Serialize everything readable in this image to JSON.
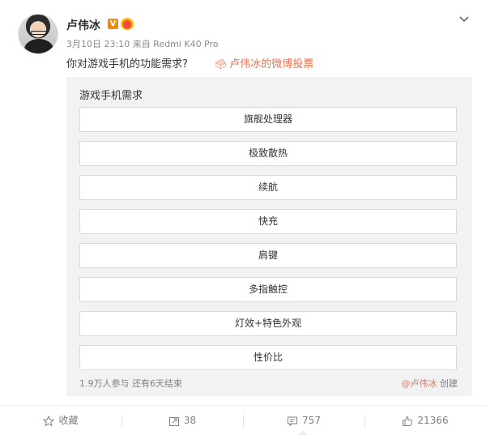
{
  "post": {
    "author": "卢伟冰",
    "verified_badge": "V",
    "meta": "3月10日 23:10 来自 Redmi K40 Pro",
    "question": "你对游戏手机的功能需求?",
    "vote_link_icon": "vote-icon",
    "vote_link": "卢伟冰的微博投票"
  },
  "poll": {
    "title": "游戏手机需求",
    "options": [
      "旗舰处理器",
      "极致散热",
      "续航",
      "快充",
      "肩键",
      "多指触控",
      "灯效+特色外观",
      "性价比"
    ],
    "stats": "1.9万人参与  还有6天结束",
    "creator_name": "@卢伟冰",
    "creator_suffix": " 创建"
  },
  "actions": {
    "favorite": "收藏",
    "repost": "38",
    "comment": "757",
    "like": "21366"
  },
  "colors": {
    "accent": "#eb7350",
    "poll_bg": "#f2f2f5",
    "verified": "#f28b0c"
  }
}
